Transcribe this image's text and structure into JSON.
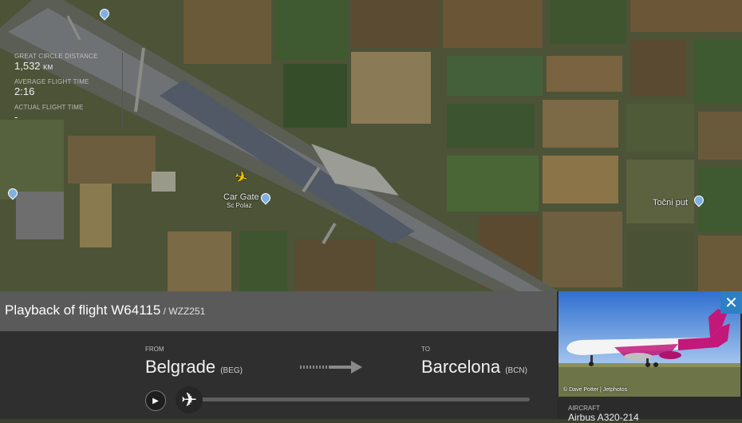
{
  "map": {
    "labels": {
      "cargo_gate": "Car Gate",
      "cargo_gate_sub": "Sc Polaz",
      "tocni_put": "Točni put"
    }
  },
  "flight": {
    "title_prefix": "Playback of flight ",
    "flight_number": "W64115",
    "callsign": " / WZZ251",
    "stats": {
      "distance_label": "GREAT CIRCLE DISTANCE",
      "distance_value": "1,532",
      "distance_unit": "KM",
      "avg_time_label": "AVERAGE FLIGHT TIME",
      "avg_time_value": "2:16",
      "actual_time_label": "ACTUAL FLIGHT TIME",
      "actual_time_value": "-"
    },
    "from_label": "FROM",
    "from_city": "Belgrade",
    "from_code": "(BEG)",
    "to_label": "TO",
    "to_city": "Barcelona",
    "to_code": "(BCN)"
  },
  "aircraft": {
    "photo_credit": "© Dave Potter | Jetphotos",
    "label": "AIRCRAFT",
    "value": "Airbus A320-214"
  },
  "icons": {
    "close": "close-icon",
    "play": "play-icon",
    "plane": "plane-icon"
  },
  "colors": {
    "accent": "#2e7fc4",
    "plane_marker": "#f5c400",
    "aircraft_livery": "#c2187a"
  }
}
